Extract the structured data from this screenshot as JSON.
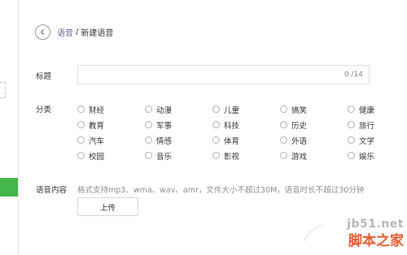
{
  "breadcrumb": {
    "prev": "语音",
    "separator": "/",
    "current": "新建语音"
  },
  "form": {
    "title_label": "标题",
    "title_value": "",
    "title_counter": "0 /14",
    "category_label": "分类",
    "categories": [
      "财经",
      "动漫",
      "儿童",
      "搞笑",
      "健康",
      "教育",
      "军事",
      "科技",
      "历史",
      "旅行",
      "汽车",
      "情感",
      "体育",
      "外语",
      "文学",
      "校园",
      "音乐",
      "影视",
      "游戏",
      "娱乐"
    ],
    "voice_label": "语音内容",
    "format_hint": "格式支持mp3、wma、wav、amr，文件大小不超过30M，语音时长不超过30分钟",
    "upload_label": "上传"
  },
  "watermark": {
    "url": "jb51.net",
    "text": "脚本之家"
  },
  "colors": {
    "accent_green": "#44b549",
    "link_blue": "#576b95",
    "watermark_orange": "#e85a2c"
  }
}
